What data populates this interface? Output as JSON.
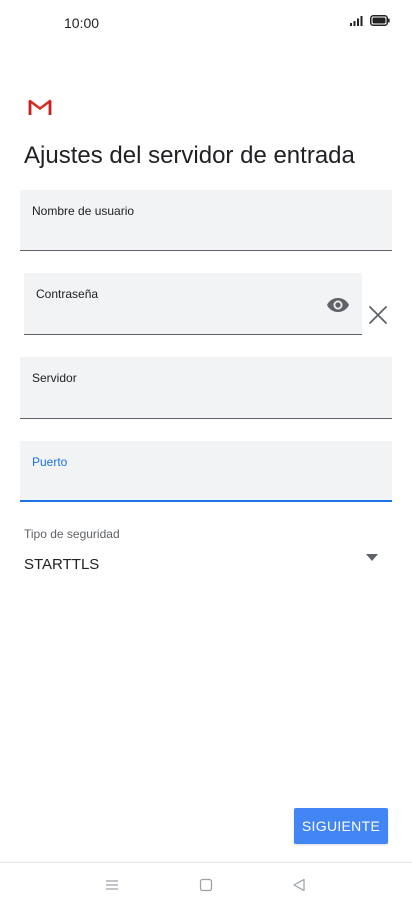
{
  "status_bar": {
    "time": "10:00",
    "icons": [
      "signal-icon",
      "battery-icon"
    ]
  },
  "app": {
    "logo": "gmail-logo",
    "accent_color": "#1a73e8",
    "logo_color": "#d93025"
  },
  "page": {
    "title": "Ajustes del servidor de entrada"
  },
  "form": {
    "username": {
      "label": "Nombre de usuario",
      "value": ""
    },
    "password": {
      "label": "Contraseña",
      "value": "",
      "toggle_icon": "eye-icon",
      "clear_icon": "close-icon"
    },
    "server": {
      "label": "Servidor",
      "value": ""
    },
    "port": {
      "label": "Puerto",
      "value": "",
      "focused": true
    },
    "security": {
      "label": "Tipo de seguridad",
      "value": "STARTTLS"
    }
  },
  "actions": {
    "next_label": "SIGUIENTE",
    "next_color": "#4285f4"
  },
  "nav_bar": {
    "icons": [
      "menu-icon",
      "home-icon",
      "back-icon"
    ]
  }
}
